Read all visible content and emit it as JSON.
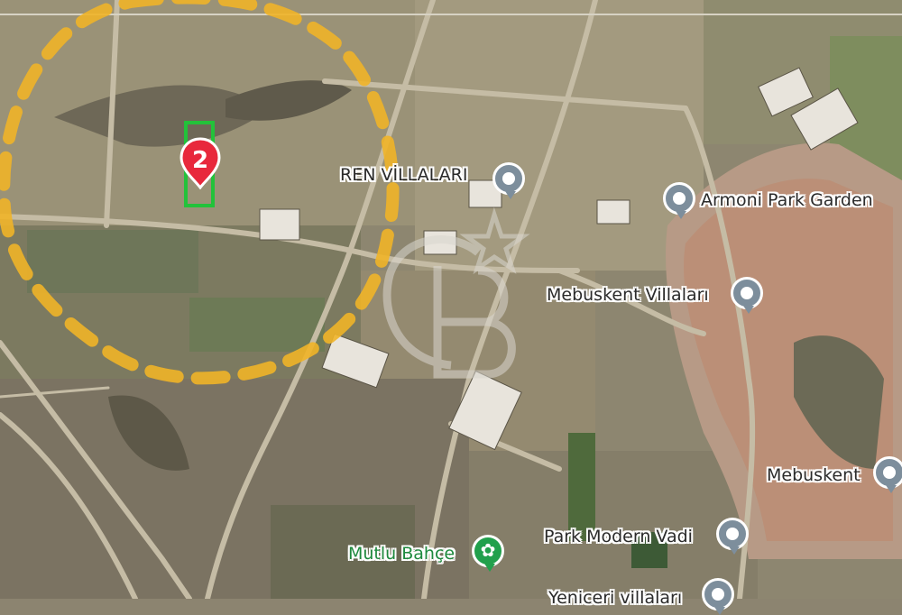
{
  "map": {
    "parcel_marker_number": "2",
    "places": [
      {
        "id": "ren",
        "label": "REN VİLLALARI"
      },
      {
        "id": "armoni",
        "label": "Armoni Park Garden"
      },
      {
        "id": "mebuskent_villalari",
        "label": "Mebuskent Villaları"
      },
      {
        "id": "mebuskent",
        "label": "Mebuskent"
      },
      {
        "id": "park_modern",
        "label": "Park Modern Vadi"
      },
      {
        "id": "mutlu",
        "label": "Mutlu Bahçe"
      },
      {
        "id": "yeniceri",
        "label": "Yeniceri villaları"
      }
    ],
    "watermark": "CB",
    "colors": {
      "boundary": "#f0b428",
      "parcel": "#22c23a",
      "marker": "#e8283c",
      "pin": "#7d8e9c",
      "green_place": "#1e8a3e"
    }
  }
}
